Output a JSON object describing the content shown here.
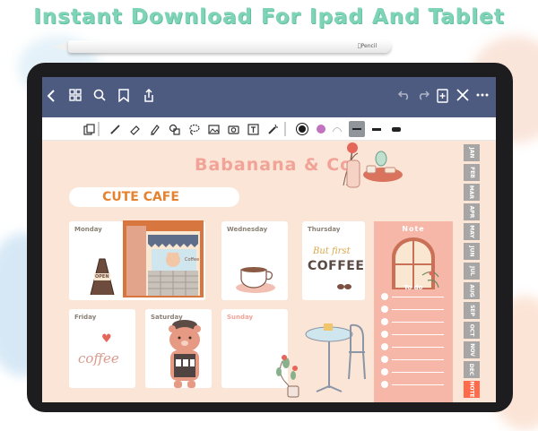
{
  "headline": "Instant Download For Ipad And Tablet",
  "pencil": {
    "brand": "Pencil"
  },
  "navbar": {
    "icons": [
      "back-icon",
      "grid-icon",
      "search-icon",
      "bookmark-icon",
      "share-icon",
      "undo-icon",
      "redo-icon",
      "add-page-icon",
      "close-icon",
      "more-icon"
    ]
  },
  "toolbar": {
    "tools": [
      "lasso-select-icon",
      "pen-icon",
      "eraser-icon",
      "highlighter-icon",
      "shapes-icon",
      "lasso-icon",
      "image-icon",
      "camera-icon",
      "text-icon",
      "laser-icon"
    ],
    "colors": {
      "black": "#1b1b1b",
      "purple": "#c172c0",
      "gray": "#9aa0a6"
    }
  },
  "planner": {
    "brand": "Babanana & Co",
    "section_title": "CUTE CAFE",
    "days": {
      "monday": "Monday",
      "wednesday": "Wednesday",
      "thursday": "Thursday",
      "friday": "Friday",
      "saturday": "Saturday",
      "sunday": "Sunday"
    },
    "shop": {
      "sign": "OPEN",
      "window": "Coffee"
    },
    "thursday_art": {
      "line1": "But first",
      "line2": "COFFEE"
    },
    "friday_art": "coffee",
    "note": {
      "title": "Note",
      "todo": "To do"
    },
    "months": [
      "JAN",
      "FEB",
      "MAR",
      "APR",
      "MAY",
      "JUN",
      "JUL",
      "AUG",
      "SEP",
      "OCT",
      "NOV",
      "DEC",
      "NOTE"
    ]
  },
  "colors": {
    "nav": "#4d5b81",
    "accent": "#f2a397",
    "orange": "#e5822f",
    "note_tab": "#ff6b4a",
    "month_tab": "#a8a5a5"
  }
}
